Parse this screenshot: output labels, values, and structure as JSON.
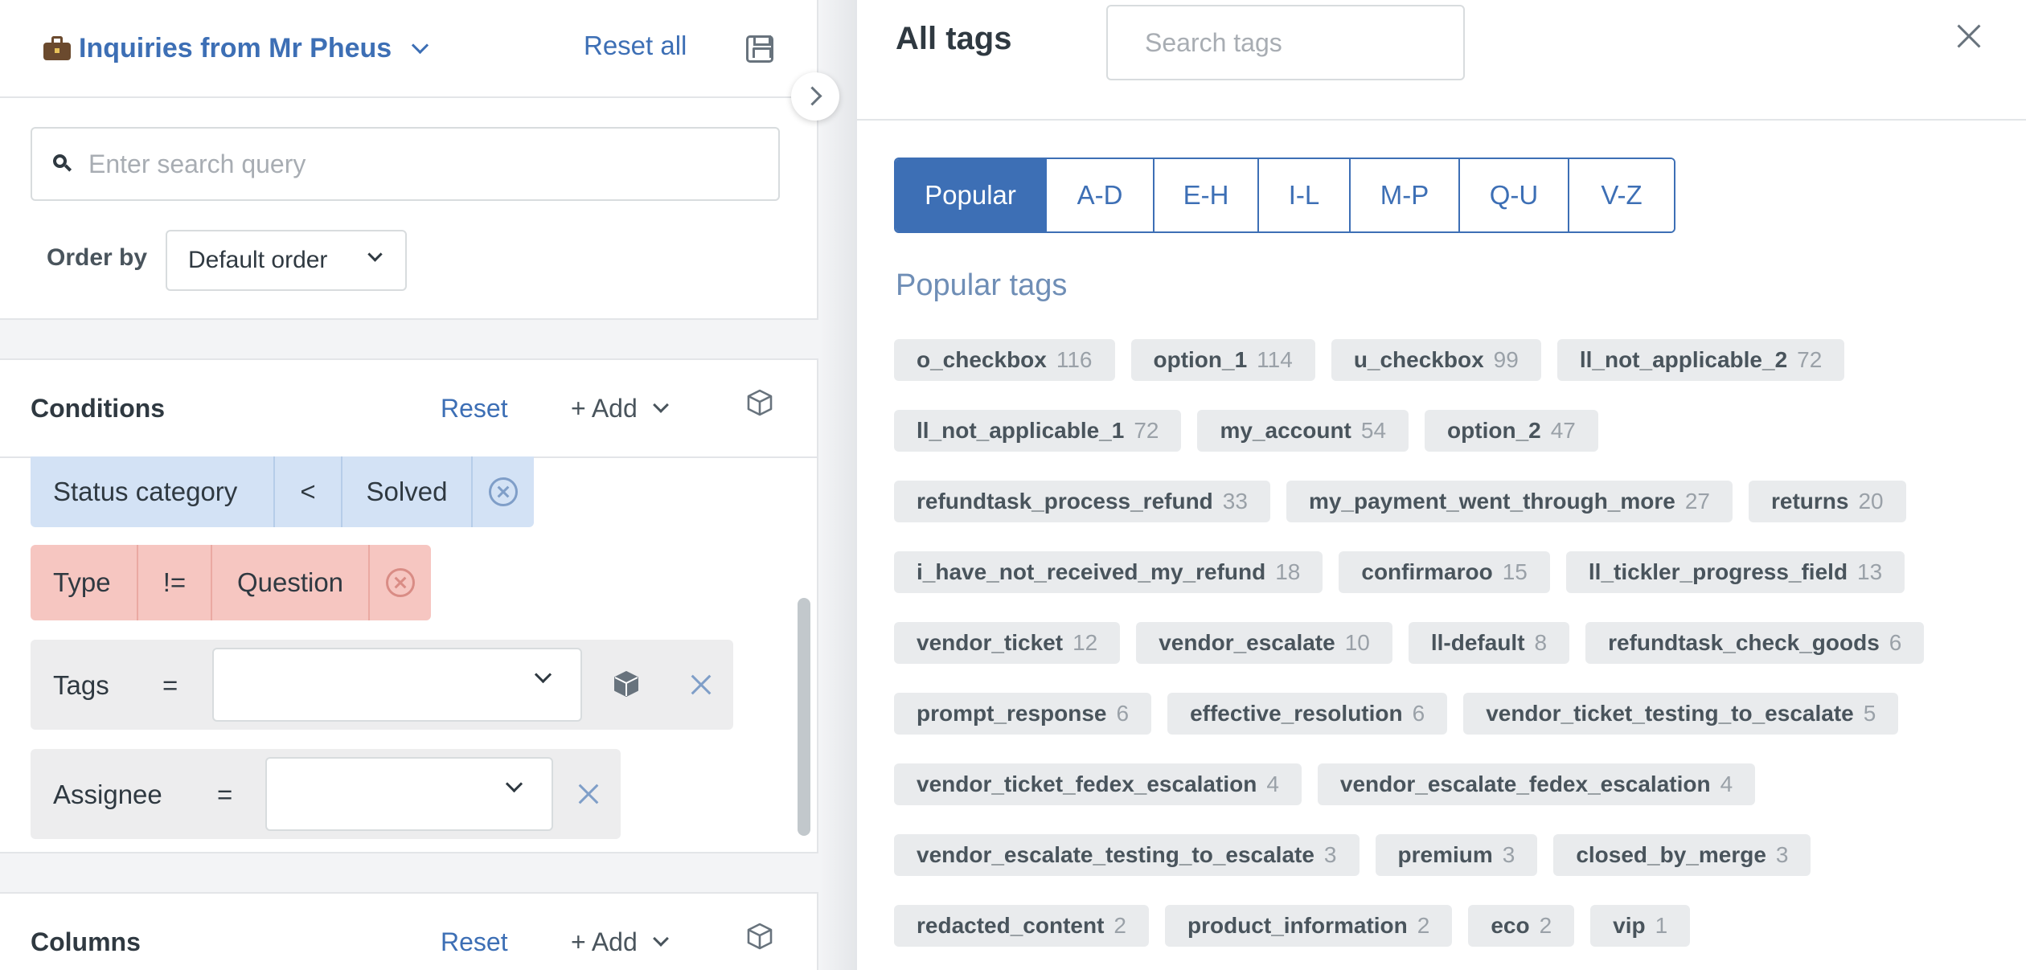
{
  "left_panel": {
    "view_title": "Inquiries from Mr Pheus",
    "reset_all": "Reset all",
    "search_placeholder": "Enter search query",
    "order_by_label": "Order by",
    "order_by_value": "Default order",
    "conditions": {
      "title": "Conditions",
      "reset": "Reset",
      "add": "+ Add",
      "status_row": {
        "field": "Status category",
        "op": "<",
        "value": "Solved"
      },
      "type_row": {
        "field": "Type",
        "op": "!=",
        "value": "Question"
      },
      "tags_row": {
        "field": "Tags",
        "op": "="
      },
      "assignee_row": {
        "field": "Assignee",
        "op": "="
      }
    },
    "columns": {
      "title": "Columns",
      "reset": "Reset",
      "add": "+ Add"
    }
  },
  "tag_panel": {
    "title": "All tags",
    "search_placeholder": "Search tags",
    "tabs": [
      "Popular",
      "A-D",
      "E-H",
      "I-L",
      "M-P",
      "Q-U",
      "V-Z"
    ],
    "active_tab": "Popular",
    "section_title": "Popular tags",
    "tags": [
      [
        {
          "name": "o_checkbox",
          "count": "116"
        },
        {
          "name": "option_1",
          "count": "114"
        },
        {
          "name": "u_checkbox",
          "count": "99"
        },
        {
          "name": "ll_not_applicable_2",
          "count": "72"
        }
      ],
      [
        {
          "name": "ll_not_applicable_1",
          "count": "72"
        },
        {
          "name": "my_account",
          "count": "54"
        },
        {
          "name": "option_2",
          "count": "47"
        }
      ],
      [
        {
          "name": "refundtask_process_refund",
          "count": "33"
        },
        {
          "name": "my_payment_went_through_more",
          "count": "27"
        },
        {
          "name": "returns",
          "count": "20"
        }
      ],
      [
        {
          "name": "i_have_not_received_my_refund",
          "count": "18"
        },
        {
          "name": "confirmaroo",
          "count": "15"
        },
        {
          "name": "ll_tickler_progress_field",
          "count": "13"
        }
      ],
      [
        {
          "name": "vendor_ticket",
          "count": "12"
        },
        {
          "name": "vendor_escalate",
          "count": "10"
        },
        {
          "name": "ll-default",
          "count": "8"
        },
        {
          "name": "refundtask_check_goods",
          "count": "6"
        }
      ],
      [
        {
          "name": "prompt_response",
          "count": "6"
        },
        {
          "name": "effective_resolution",
          "count": "6"
        },
        {
          "name": "vendor_ticket_testing_to_escalate",
          "count": "5"
        }
      ],
      [
        {
          "name": "vendor_ticket_fedex_escalation",
          "count": "4"
        },
        {
          "name": "vendor_escalate_fedex_escalation",
          "count": "4"
        }
      ],
      [
        {
          "name": "vendor_escalate_testing_to_escalate",
          "count": "3"
        },
        {
          "name": "premium",
          "count": "3"
        },
        {
          "name": "closed_by_merge",
          "count": "3"
        }
      ],
      [
        {
          "name": "redacted_content",
          "count": "2"
        },
        {
          "name": "product_information",
          "count": "2"
        },
        {
          "name": "eco",
          "count": "2"
        },
        {
          "name": "vip",
          "count": "1"
        }
      ]
    ]
  },
  "colors": {
    "accent": "#3d6fb5",
    "status_bg": "#d3e2f5",
    "type_bg": "#f6c6c1",
    "tag_bg": "#e9ebed"
  },
  "icons": [
    "briefcase-icon",
    "chevron-down-icon",
    "save-icon",
    "search-icon",
    "cube-icon",
    "close-icon",
    "remove-circle-icon",
    "collapse-arrow-icon"
  ]
}
